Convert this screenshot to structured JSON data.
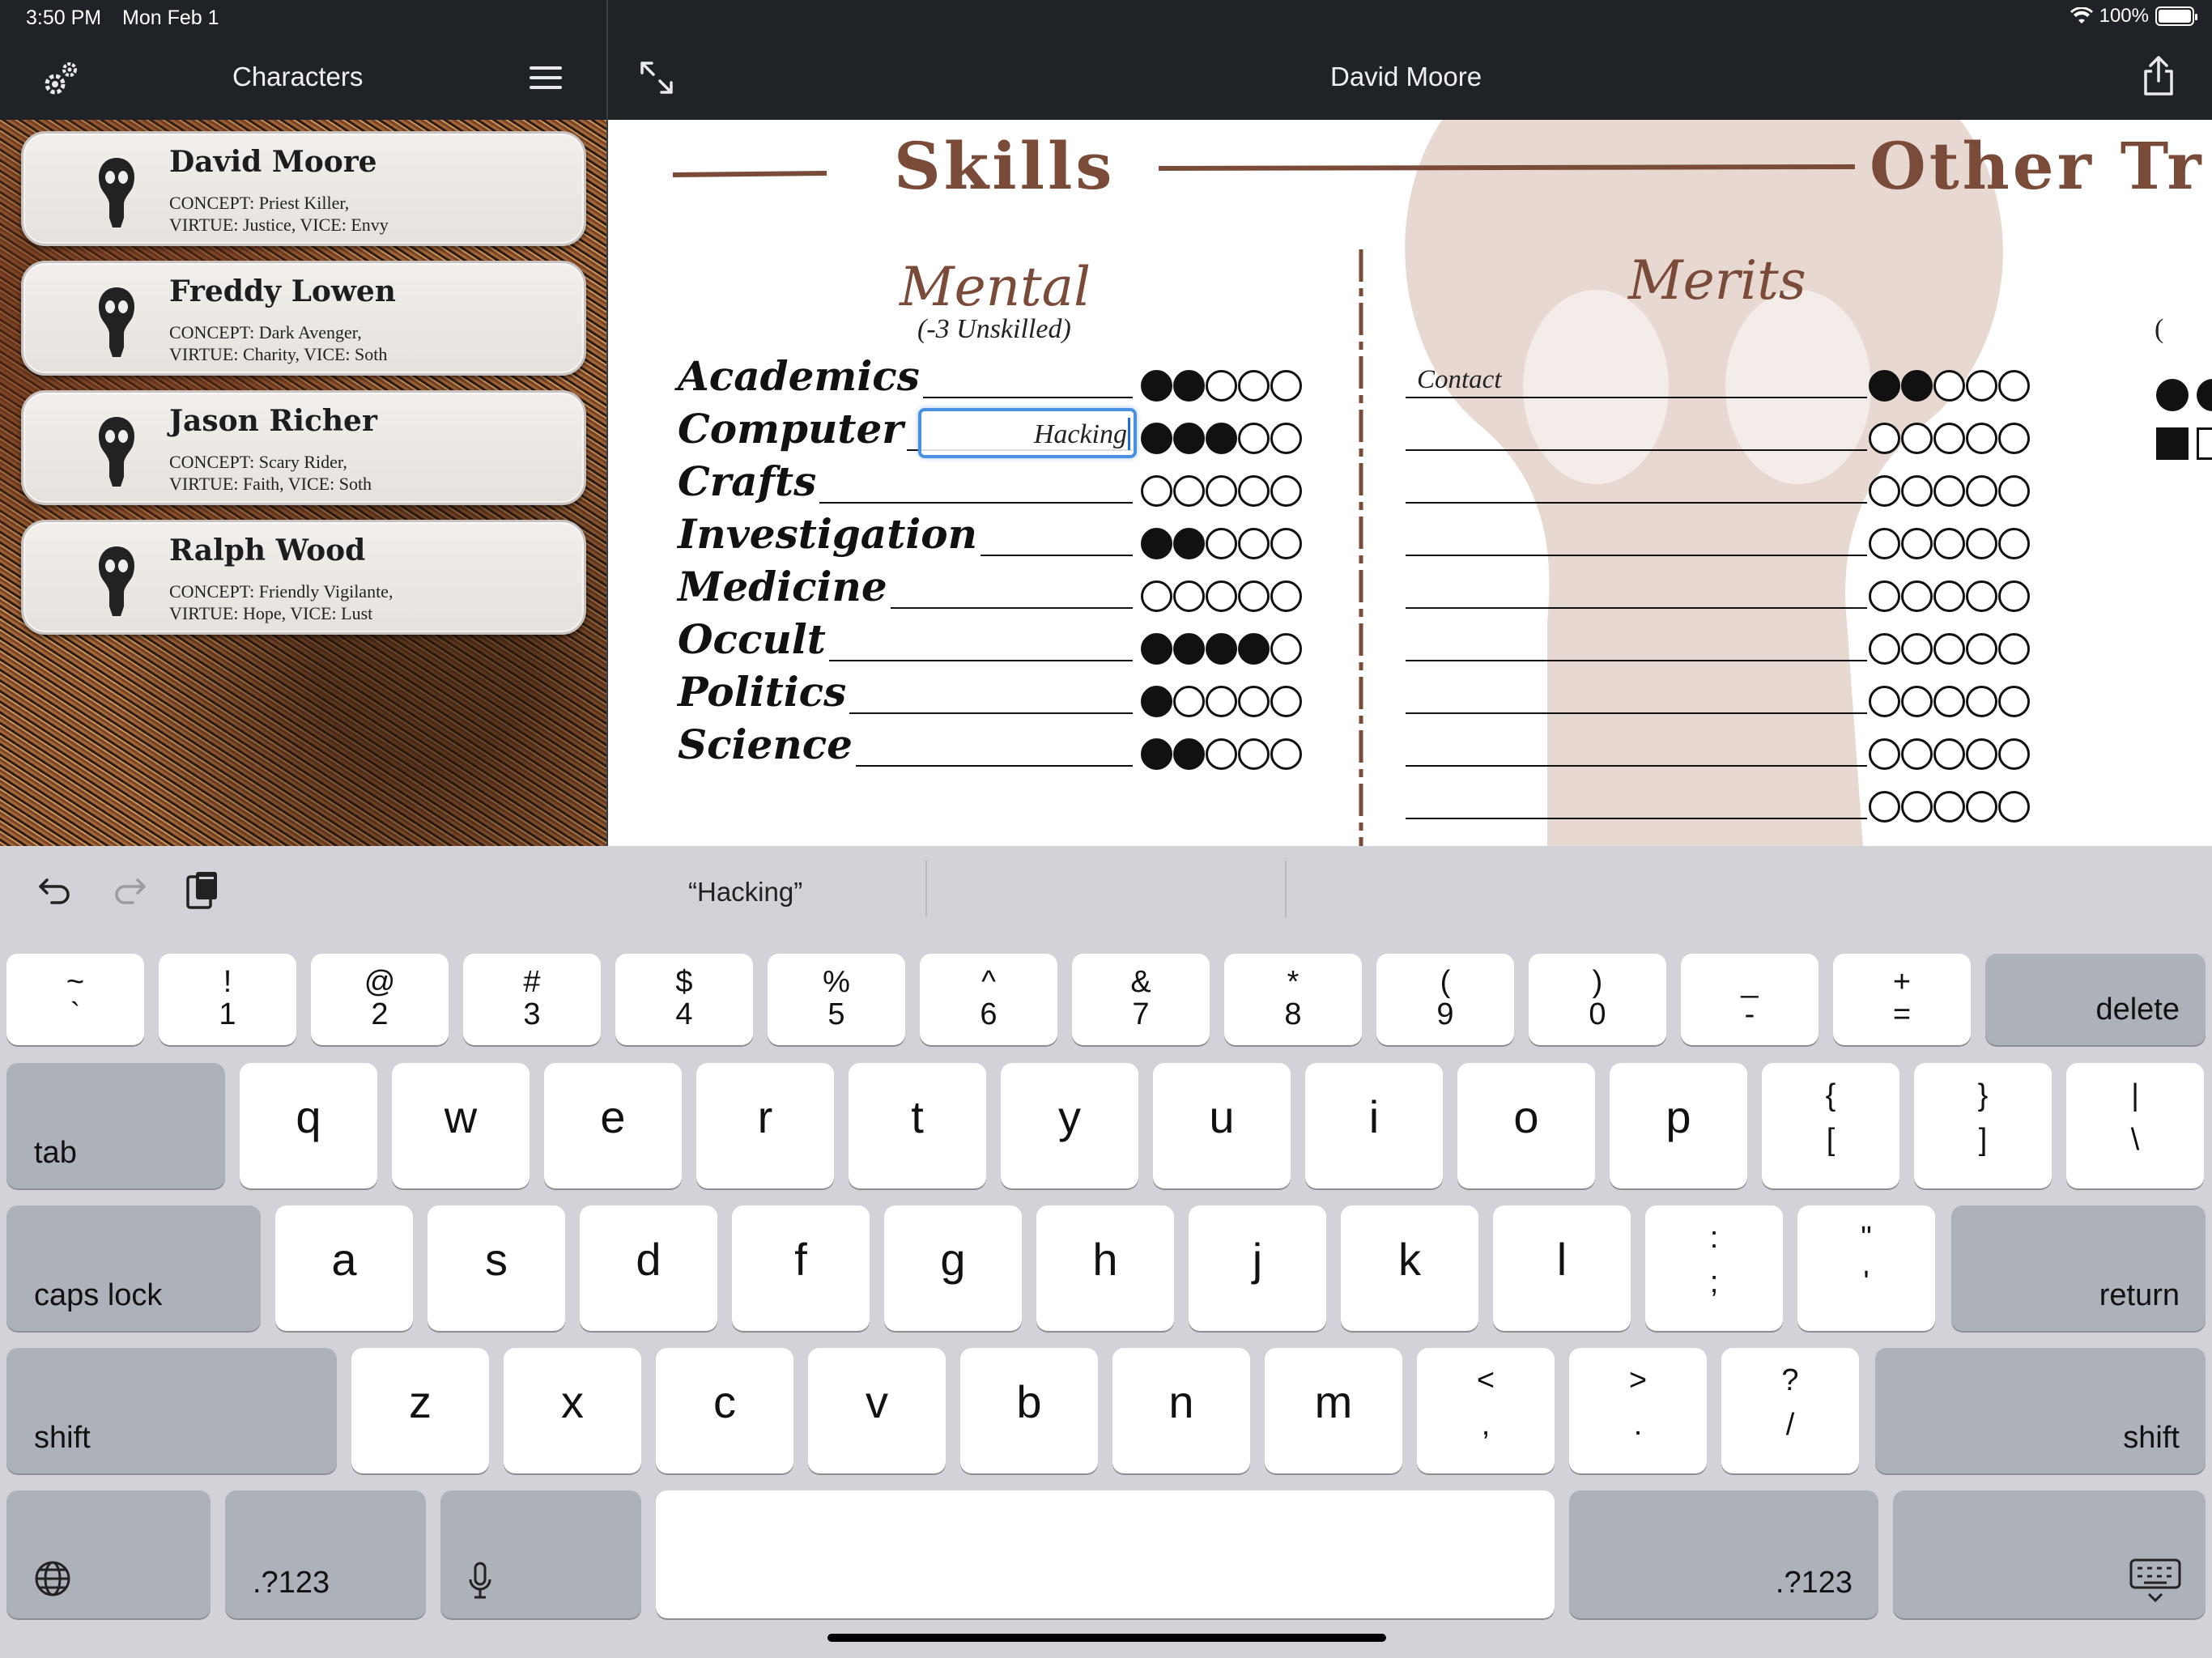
{
  "status": {
    "time": "3:50 PM",
    "date": "Mon Feb 1",
    "battery": "100%"
  },
  "sidebar": {
    "title": "Characters",
    "characters": [
      {
        "name": "David Moore",
        "line1": "CONCEPT: Priest Killer,",
        "line2": "VIRTUE: Justice, VICE: Envy"
      },
      {
        "name": "Freddy Lowen",
        "line1": "CONCEPT: Dark Avenger,",
        "line2": "VIRTUE: Charity, VICE: Soth"
      },
      {
        "name": "Jason Richer",
        "line1": "CONCEPT: Scary Rider,",
        "line2": "VIRTUE: Faith, VICE: Soth"
      },
      {
        "name": "Ralph Wood",
        "line1": "CONCEPT: Friendly Vigilante,",
        "line2": "VIRTUE: Hope, VICE: Lust"
      }
    ]
  },
  "detail": {
    "title": "David Moore"
  },
  "sheet": {
    "skills_heading": "Skills",
    "other_heading": "Other Tr",
    "mental_title": "Mental",
    "unskilled_note": "(-3 Unskilled)",
    "merits_title": "Merits",
    "specialty_value": "Hacking",
    "skills": [
      {
        "name": "Academics",
        "dots": 2
      },
      {
        "name": "Computer",
        "dots": 3
      },
      {
        "name": "Crafts",
        "dots": 0
      },
      {
        "name": "Investigation",
        "dots": 2
      },
      {
        "name": "Medicine",
        "dots": 0
      },
      {
        "name": "Occult",
        "dots": 4
      },
      {
        "name": "Politics",
        "dots": 1
      },
      {
        "name": "Science",
        "dots": 2
      }
    ],
    "merits": [
      {
        "name": "Contact",
        "dots": 2
      },
      {
        "name": "",
        "dots": 0
      },
      {
        "name": "",
        "dots": 0
      },
      {
        "name": "",
        "dots": 0
      },
      {
        "name": "",
        "dots": 0
      },
      {
        "name": "",
        "dots": 0
      },
      {
        "name": "",
        "dots": 0
      },
      {
        "name": "",
        "dots": 0
      },
      {
        "name": "",
        "dots": 0
      }
    ],
    "max_dots": 5
  },
  "keyboard": {
    "suggestion": "“Hacking”",
    "number_row": [
      {
        "top": "~",
        "bot": "`"
      },
      {
        "top": "!",
        "bot": "1"
      },
      {
        "top": "@",
        "bot": "2"
      },
      {
        "top": "#",
        "bot": "3"
      },
      {
        "top": "$",
        "bot": "4"
      },
      {
        "top": "%",
        "bot": "5"
      },
      {
        "top": "^",
        "bot": "6"
      },
      {
        "top": "&",
        "bot": "7"
      },
      {
        "top": "*",
        "bot": "8"
      },
      {
        "top": "(",
        "bot": "9"
      },
      {
        "top": ")",
        "bot": "0"
      },
      {
        "top": "_",
        "bot": "-"
      },
      {
        "top": "+",
        "bot": "="
      }
    ],
    "row_q": [
      "q",
      "w",
      "e",
      "r",
      "t",
      "y",
      "u",
      "i",
      "o",
      "p"
    ],
    "row_q_extra": [
      {
        "top": "{",
        "bot": "["
      },
      {
        "top": "}",
        "bot": "]"
      },
      {
        "top": "|",
        "bot": "\\"
      }
    ],
    "row_a": [
      "a",
      "s",
      "d",
      "f",
      "g",
      "h",
      "j",
      "k",
      "l"
    ],
    "row_a_extra": [
      {
        "top": ":",
        "bot": ";"
      },
      {
        "top": "\"",
        "bot": "'"
      }
    ],
    "row_z": [
      "z",
      "x",
      "c",
      "v",
      "b",
      "n",
      "m"
    ],
    "row_z_extra": [
      {
        "top": "<",
        "bot": ","
      },
      {
        "top": ">",
        "bot": "."
      },
      {
        "top": "?",
        "bot": "/"
      }
    ],
    "delete_label": "delete",
    "tab_label": "tab",
    "caps_label": "caps lock",
    "return_label": "return",
    "shift_label": "shift",
    "numbers_label": ".?123"
  }
}
